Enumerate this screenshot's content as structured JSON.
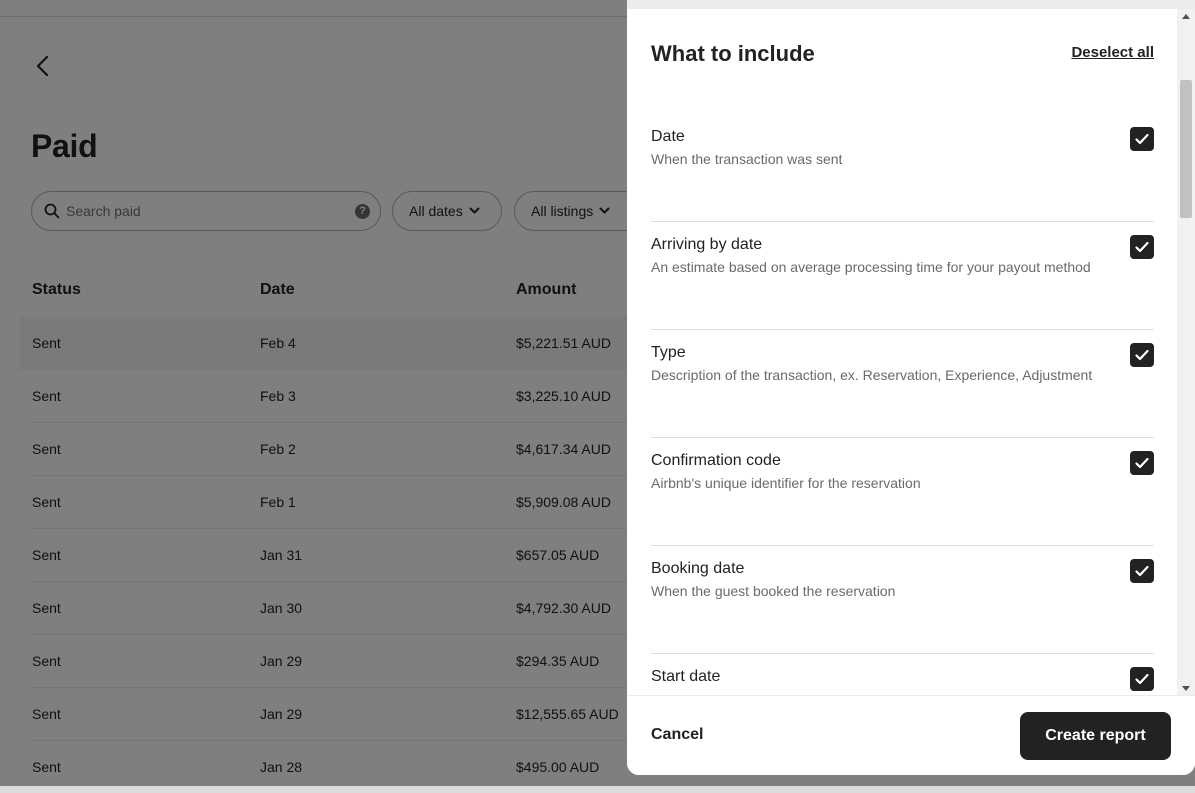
{
  "page": {
    "title": "Paid",
    "search": {
      "placeholder": "Search paid",
      "help_glyph": "?"
    },
    "filters": {
      "dates": "All dates",
      "listings": "All listings"
    },
    "table": {
      "headers": [
        "Status",
        "Date",
        "Amount"
      ],
      "rows": [
        {
          "status": "Sent",
          "date": "Feb 4",
          "amount": "$5,221.51 AUD"
        },
        {
          "status": "Sent",
          "date": "Feb 3",
          "amount": "$3,225.10 AUD"
        },
        {
          "status": "Sent",
          "date": "Feb 2",
          "amount": "$4,617.34 AUD"
        },
        {
          "status": "Sent",
          "date": "Feb 1",
          "amount": "$5,909.08 AUD"
        },
        {
          "status": "Sent",
          "date": "Jan 31",
          "amount": "$657.05 AUD"
        },
        {
          "status": "Sent",
          "date": "Jan 30",
          "amount": "$4,792.30 AUD"
        },
        {
          "status": "Sent",
          "date": "Jan 29",
          "amount": "$294.35 AUD"
        },
        {
          "status": "Sent",
          "date": "Jan 29",
          "amount": "$12,555.65 AUD"
        },
        {
          "status": "Sent",
          "date": "Jan 28",
          "amount": "$495.00 AUD"
        }
      ]
    }
  },
  "panel": {
    "heading": "What to include",
    "deselect_label": "Deselect all",
    "options": [
      {
        "label": "Date",
        "description": "When the transaction was sent",
        "checked": true
      },
      {
        "label": "Arriving by date",
        "description": "An estimate based on average processing time for your payout method",
        "checked": true
      },
      {
        "label": "Type",
        "description": "Description of the transaction, ex. Reservation, Experience, Adjustment",
        "checked": true
      },
      {
        "label": "Confirmation code",
        "description": "Airbnb's unique identifier for the reservation",
        "checked": true
      },
      {
        "label": "Booking date",
        "description": "When the guest booked the reservation",
        "checked": true
      },
      {
        "label": "Start date",
        "description": "",
        "checked": true
      }
    ],
    "cancel_label": "Cancel",
    "create_label": "Create report"
  }
}
